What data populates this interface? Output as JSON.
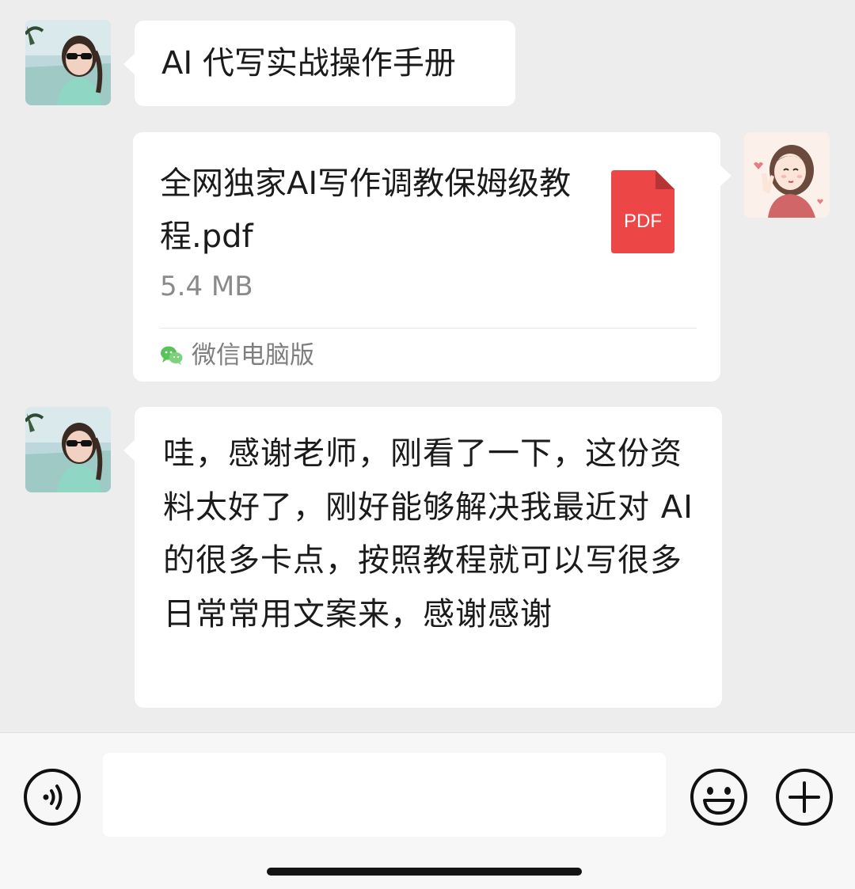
{
  "colors": {
    "chat_background": "#ededed",
    "bubble_background": "#ffffff",
    "pdf_badge": "#ec4646",
    "wechat_green": "#59c25a",
    "secondary_text": "#8a8a8a"
  },
  "messages": [
    {
      "sender": "other",
      "avatar_icon": "girl-with-sunglasses-avatar",
      "type": "text",
      "text": "AI 代写实战操作手册"
    },
    {
      "sender": "self",
      "avatar_icon": "cartoon-girl-avatar",
      "type": "file",
      "file_name": "全网独家AI写作调教保姆级教程.pdf",
      "file_size": "5.4 MB",
      "file_badge": "PDF",
      "source_icon": "wechat-icon",
      "source": "微信电脑版"
    },
    {
      "sender": "other",
      "avatar_icon": "girl-with-sunglasses-avatar",
      "type": "text",
      "text": "哇，感谢老师，刚看了一下，这份资料太好了，刚好能够解决我最近对 AI 的很多卡点，按照教程就可以写很多日常常用文案来，感谢感谢"
    }
  ],
  "input_bar": {
    "voice_icon": "voice-input-icon",
    "input_value": "",
    "emoji_icon": "emoji-icon",
    "more_icon": "plus-icon"
  }
}
